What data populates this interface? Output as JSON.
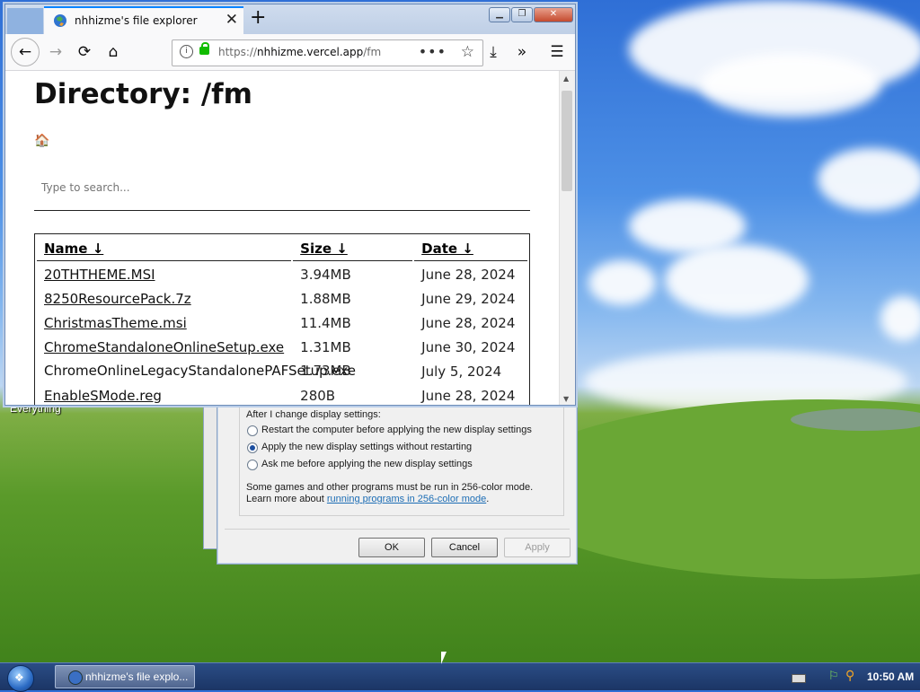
{
  "browser": {
    "tab_title": "nhhizme's file explorer",
    "url_proto": "https://",
    "url_host": "nhhizme.vercel.app",
    "url_path": "/fm"
  },
  "page": {
    "heading": "Directory: /fm",
    "search_placeholder": "Type to search...",
    "columns": [
      "Name ↓",
      "Size ↓",
      "Date ↓"
    ],
    "rows": [
      {
        "name": "20THTHEME.MSI",
        "size": "3.94MB",
        "date": "June 28, 2024"
      },
      {
        "name": "8250ResourcePack.7z",
        "size": "1.88MB",
        "date": "June 29, 2024"
      },
      {
        "name": "ChristmasTheme.msi",
        "size": "11.4MB",
        "date": "June 28, 2024"
      },
      {
        "name": "ChromeStandaloneOnlineSetup.exe",
        "size": "1.31MB",
        "date": "June 30, 2024"
      },
      {
        "name": "ChromeOnlineLegacyStandalonePAFSetup.exe",
        "size": "1.73MB",
        "date": "July 5, 2024"
      },
      {
        "name": "EnableSMode.reg",
        "size": "280B",
        "date": "June 28, 2024"
      }
    ]
  },
  "dialog": {
    "group_label": "After I change display settings:",
    "options": [
      "Restart the computer before applying the new display settings",
      "Apply the new display settings without restarting",
      "Ask me before applying the new display settings"
    ],
    "selected_index": 1,
    "note_line1": "Some games and other programs must be run in 256-color mode.",
    "note_line2_prefix": "Learn more about ",
    "note_link": "running programs in 256-color mode",
    "note_suffix": ".",
    "ok": "OK",
    "cancel": "Cancel",
    "apply": "Apply"
  },
  "desktop": {
    "label": "Everything"
  },
  "taskbar": {
    "task_label": "nhhizme's file explo...",
    "clock": "10:50 AM"
  }
}
